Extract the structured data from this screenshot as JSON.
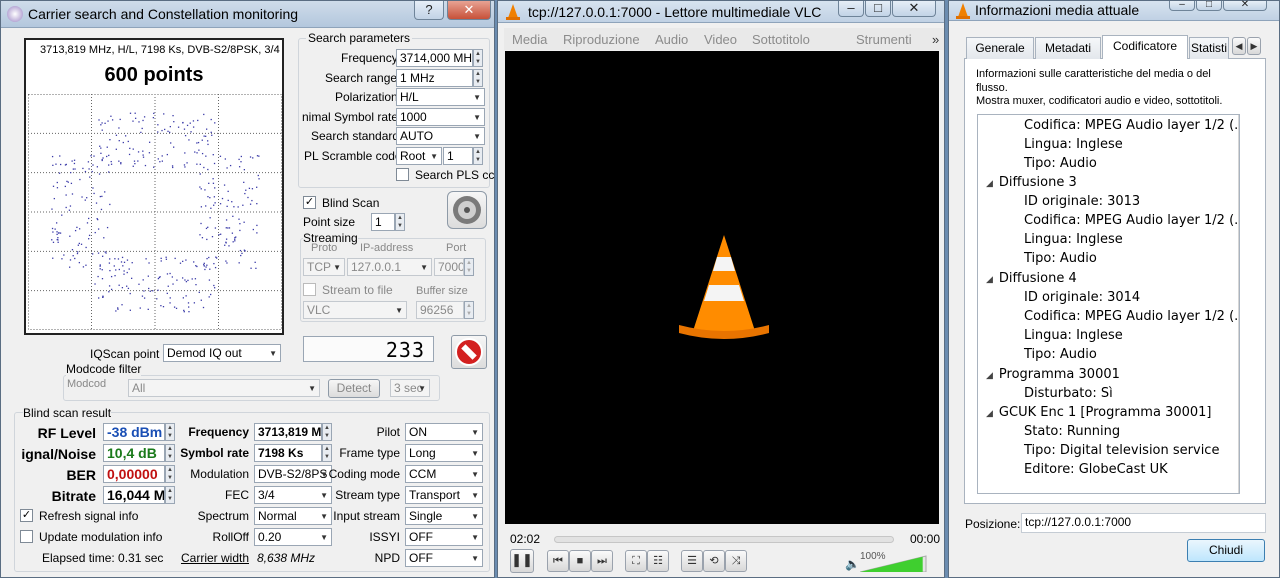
{
  "w1": {
    "title": "Carrier search and Constellation monitoring",
    "help": "?",
    "close": "✕",
    "constellation": {
      "info": "3713,819 MHz, H/L, 7198 Ks, DVB-S2/8PSK, 3/4",
      "points": "600 points"
    },
    "search": {
      "heading": "Search parameters",
      "freq_label": "Frequency",
      "freq": "3714,000 MHz",
      "range_label": "Search range",
      "range": "1 MHz",
      "pol_label": "Polarization",
      "pol": "H/L",
      "msr_label": "nimal Symbol rate",
      "msr": "1000",
      "std_label": "Search standard",
      "std": "AUTO",
      "pl_label": "PL Scramble code",
      "pl_mode": "Root",
      "pl_val": "1",
      "pls_label": "Search PLS cc"
    },
    "blind": {
      "label": "Blind Scan",
      "point_size_label": "Point size",
      "point_size": "1"
    },
    "stream": {
      "heading": "Streaming",
      "proto_h": "Proto",
      "ip_h": "IP-address",
      "port_h": "Port",
      "proto": "TCP",
      "ip": "127.0.0.1",
      "port": "7000",
      "file_label": "Stream to file",
      "buf_label": "Buffer size",
      "player": "VLC",
      "buf": "96256"
    },
    "counter": "233",
    "iq": {
      "label": "IQScan point",
      "value": "Demod IQ out"
    },
    "modcode": {
      "heading": "Modcode filter",
      "label": "Modcod",
      "value": "All",
      "detect": "Detect",
      "sec": "3 sec"
    },
    "result": {
      "heading": "Blind scan result",
      "rf_label": "RF Level",
      "rf": "-38 dBm",
      "snr_label": "ignal/Noise",
      "snr": "10,4 dB",
      "ber_label": "BER",
      "ber": "0,00000",
      "bitrate_label": "Bitrate",
      "bitrate": "16,044 M",
      "freq_label": "Frequency",
      "freq": "3713,819 M",
      "sr_label": "Symbol rate",
      "sr": "7198 Ks",
      "mod_label": "Modulation",
      "mod": "DVB-S2/8PS",
      "fec_label": "FEC",
      "fec": "3/4",
      "spec_label": "Spectrum",
      "spec": "Normal",
      "roll_label": "RollOff",
      "roll": "0.20",
      "cw_label": "Carrier width",
      "cw": "8,638 MHz",
      "pilot_label": "Pilot",
      "pilot": "ON",
      "frame_label": "Frame type",
      "frame": "Long",
      "coding_label": "Coding mode",
      "coding": "CCM",
      "stype_label": "Stream type",
      "stype": "Transport",
      "input_label": "Input stream",
      "input": "Single",
      "issyi_label": "ISSYI",
      "issyi": "OFF",
      "npd_label": "NPD",
      "npd": "OFF",
      "refresh_label": "Refresh signal info",
      "update_label": "Update modulation info",
      "elapsed": "Elapsed time: 0.31 sec"
    }
  },
  "w2": {
    "title": "tcp://127.0.0.1:7000 - Lettore multimediale VLC",
    "menu": [
      "Media",
      "Riproduzione",
      "Audio",
      "Video",
      "Sottotitolo",
      "Strumenti"
    ],
    "more": "»",
    "elapsed": "02:02",
    "total": "00:00",
    "volume": "100%"
  },
  "w3": {
    "title": "Informazioni media attuale",
    "tabs": [
      "Generale",
      "Metadati",
      "Codificatore",
      "Statisti"
    ],
    "desc1": "Informazioni sulle caratteristiche del media o del flusso.",
    "desc2": "Mostra muxer, codificatori audio e video, sottotitoli.",
    "tree": [
      {
        "t": "Codifica: MPEG Audio layer 1/2 (..."
      },
      {
        "t": "Lingua: Inglese"
      },
      {
        "t": "Tipo: Audio"
      },
      {
        "t": "Diffusione 3"
      },
      {
        "t": "ID originale: 3013"
      },
      {
        "t": "Codifica: MPEG Audio layer 1/2 (..."
      },
      {
        "t": "Lingua: Inglese"
      },
      {
        "t": "Tipo: Audio"
      },
      {
        "t": "Diffusione 4"
      },
      {
        "t": "ID originale: 3014"
      },
      {
        "t": "Codifica: MPEG Audio layer 1/2 (..."
      },
      {
        "t": "Lingua: Inglese"
      },
      {
        "t": "Tipo: Audio"
      },
      {
        "t": "Programma 30001"
      },
      {
        "t": "Disturbato: Sì"
      },
      {
        "t": "GCUK Enc 1 [Programma 30001]"
      },
      {
        "t": "Stato: Running"
      },
      {
        "t": "Tipo: Digital television service"
      },
      {
        "t": "Editore: GlobeCast UK"
      }
    ],
    "pos_label": "Posizione:",
    "pos": "tcp://127.0.0.1:7000",
    "close": "Chiudi"
  }
}
